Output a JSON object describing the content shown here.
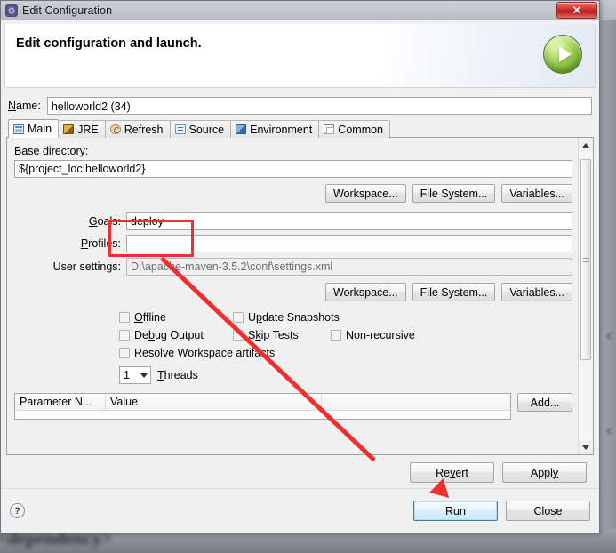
{
  "window": {
    "title": "Edit Configuration",
    "title_icon": "maven-configuration-icon",
    "close_label": "✕"
  },
  "header": {
    "heading": "Edit configuration and launch.",
    "run_badge_icon": "green-play-icon"
  },
  "name_field": {
    "label": "Name:",
    "value": "helloworld2 (34)"
  },
  "tabs": [
    {
      "label": "Main",
      "icon": "main-tab-icon",
      "active": true
    },
    {
      "label": "JRE",
      "icon": "jre-tab-icon",
      "active": false
    },
    {
      "label": "Refresh",
      "icon": "refresh-tab-icon",
      "active": false
    },
    {
      "label": "Source",
      "icon": "source-tab-icon",
      "active": false
    },
    {
      "label": "Environment",
      "icon": "environment-tab-icon",
      "active": false
    },
    {
      "label": "Common",
      "icon": "common-tab-icon",
      "active": false
    }
  ],
  "main_tab": {
    "base_directory": {
      "label": "Base directory:",
      "value": "${project_loc:helloworld2}"
    },
    "browse_buttons": [
      {
        "label": "Workspace...",
        "name": "workspace-button"
      },
      {
        "label": "File System...",
        "name": "file-system-button"
      },
      {
        "label": "Variables...",
        "name": "variables-button"
      }
    ],
    "goals": {
      "label": "Goals:",
      "value": "deploy"
    },
    "profiles": {
      "label": "Profiles:",
      "value": ""
    },
    "user_settings": {
      "label": "User settings:",
      "value": "D:\\apache-maven-3.5.2\\conf\\settings.xml"
    },
    "browse_buttons2": [
      {
        "label": "Workspace...",
        "name": "workspace-button-2"
      },
      {
        "label": "File System...",
        "name": "file-system-button-2"
      },
      {
        "label": "Variables...",
        "name": "variables-button-2"
      }
    ],
    "checkboxes": [
      {
        "label": "Offline",
        "checked": false,
        "name": "offline-checkbox"
      },
      {
        "label": "Update Snapshots",
        "checked": false,
        "name": "update-snapshots-checkbox"
      },
      {
        "label": "Debug Output",
        "checked": false,
        "name": "debug-output-checkbox"
      },
      {
        "label": "Skip Tests",
        "checked": false,
        "name": "skip-tests-checkbox"
      },
      {
        "label": "Non-recursive",
        "checked": false,
        "name": "non-recursive-checkbox"
      },
      {
        "label": "Resolve Workspace artifacts",
        "checked": false,
        "name": "resolve-workspace-artifacts-checkbox"
      }
    ],
    "threads": {
      "value": "1",
      "label": "Threads"
    },
    "parameter_table": {
      "columns": [
        "Parameter N...",
        "Value",
        ""
      ],
      "rows": [],
      "add_button": "Add..."
    }
  },
  "mid_buttons": [
    {
      "label": "Revert",
      "name": "revert-button"
    },
    {
      "label": "Apply",
      "name": "apply-button"
    }
  ],
  "footer": {
    "help_icon": "help-icon",
    "help_glyph": "?",
    "buttons": [
      {
        "label": "Run",
        "name": "run-button",
        "focused": true
      },
      {
        "label": "Close",
        "name": "close-button",
        "focused": false
      }
    ]
  },
  "annotation": {
    "highlight_target": "goals-field",
    "arrow_target": "run-button",
    "color": "#ee2f2f"
  },
  "background": {
    "bottom_text": "<dependency>",
    "right_chars": [
      "c",
      "c"
    ]
  }
}
